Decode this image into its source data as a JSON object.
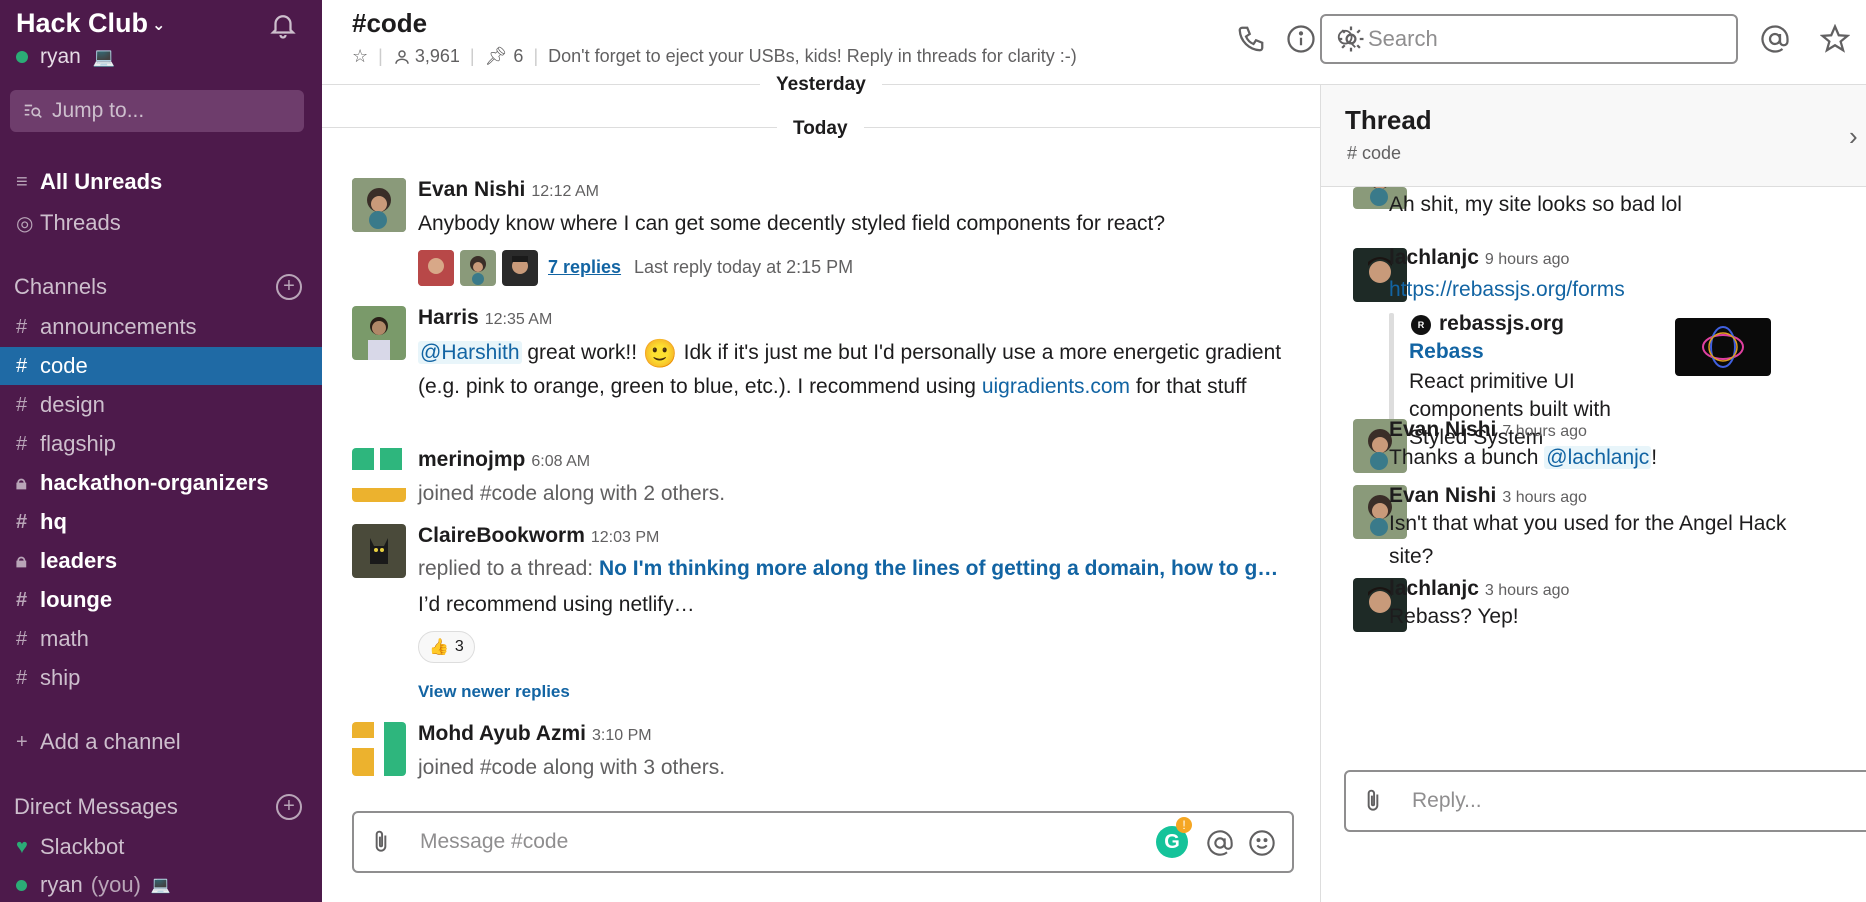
{
  "workspace": {
    "name": "Hack Club",
    "user": "ryan"
  },
  "sidebar": {
    "jump_placeholder": "Jump to...",
    "all_unreads": "All Unreads",
    "threads": "Threads",
    "channels_header": "Channels",
    "channels": [
      {
        "name": "announcements",
        "prefix": "#",
        "bold": false,
        "active": false
      },
      {
        "name": "code",
        "prefix": "#",
        "bold": false,
        "active": true
      },
      {
        "name": "design",
        "prefix": "#",
        "bold": false,
        "active": false
      },
      {
        "name": "flagship",
        "prefix": "#",
        "bold": false,
        "active": false
      },
      {
        "name": "hackathon-organizers",
        "prefix": "lock",
        "bold": true,
        "active": false
      },
      {
        "name": "hq",
        "prefix": "#",
        "bold": true,
        "active": false
      },
      {
        "name": "leaders",
        "prefix": "lock",
        "bold": true,
        "active": false
      },
      {
        "name": "lounge",
        "prefix": "#",
        "bold": true,
        "active": false
      },
      {
        "name": "math",
        "prefix": "#",
        "bold": false,
        "active": false
      },
      {
        "name": "ship",
        "prefix": "#",
        "bold": false,
        "active": false
      }
    ],
    "add_channel": "Add a channel",
    "dm_header": "Direct Messages",
    "dms": [
      {
        "name": "Slackbot",
        "suffix": ""
      },
      {
        "name": "ryan",
        "suffix": "(you)"
      }
    ]
  },
  "channel": {
    "title": "#code",
    "members": "3,961",
    "pins": "6",
    "topic": "Don't forget to eject your USBs, kids! Reply in threads for clarity :-)",
    "search_placeholder": "Search"
  },
  "days": {
    "yesterday": "Yesterday",
    "today": "Today"
  },
  "messages": [
    {
      "author": "Evan Nishi",
      "time": "12:12 AM",
      "text": "Anybody know  where I can get some decently styled field components for react?",
      "replies": "7 replies",
      "last_reply": "Last reply today at 2:15 PM"
    },
    {
      "author": "Harris",
      "time": "12:35 AM",
      "mention": "@Harshith",
      "text_a": " great work!! ",
      "emoji": "🙂",
      "text_b": " Idk if it's just me but I'd personally use a more energetic gradient (e.g. pink to orange, green to blue, etc.). I recommend using ",
      "link": "uigradients.com",
      "text_c": " for that stuff"
    },
    {
      "author": "merinojmp",
      "time": "6:08 AM",
      "text": "joined #code along with 2 others."
    },
    {
      "author": "ClaireBookworm",
      "time": "12:03 PM",
      "replied_prefix": "replied to a thread: ",
      "replied_link": "No I'm thinking more along the lines of getting a domain, how to g…",
      "text": "I’d recommend using netlify…",
      "reaction_emoji": "👍",
      "reaction_count": "3",
      "newer_replies": "View newer replies"
    },
    {
      "author": "Mohd Ayub Azmi",
      "time": "3:10 PM",
      "text": "joined #code along with 3 others."
    }
  ],
  "composer": {
    "placeholder": "Message #code"
  },
  "thread": {
    "title": "Thread",
    "channel": "# code",
    "top_text": "Ah shit, my site looks so bad lol",
    "items": [
      {
        "author": "lachlanjc",
        "time": "9 hours ago",
        "link": "https://rebassjs.org/forms",
        "unfurl_site": "rebassjs.org",
        "unfurl_title": "Rebass",
        "unfurl_desc": "React primitive UI components built with Styled System"
      },
      {
        "author": "Evan Nishi",
        "time": "7 hours ago",
        "text_a": "Thanks a bunch ",
        "mention": "@lachlanjc",
        "text_b": "!"
      },
      {
        "author": "Evan Nishi",
        "time": "3 hours ago",
        "text": "Isn't that what you used for the Angel Hack site?"
      },
      {
        "author": "lachlanjc",
        "time": "3 hours ago",
        "text": "Rebass? Yep!"
      }
    ],
    "reply_placeholder": "Reply..."
  }
}
